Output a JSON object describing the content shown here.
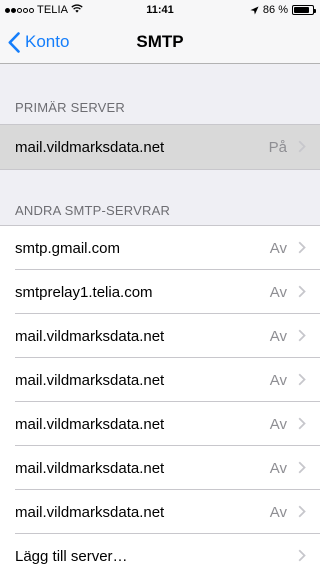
{
  "status_bar": {
    "signal": [
      true,
      true,
      false,
      false,
      false
    ],
    "carrier": "TELIA",
    "time": "11:41",
    "battery_text": "86 %",
    "battery_level": 0.86
  },
  "nav": {
    "back_label": "Konto",
    "title": "SMTP"
  },
  "primary": {
    "header": "PRIMÄR SERVER",
    "server": {
      "label": "mail.vildmarksdata.net",
      "status": "På"
    }
  },
  "others": {
    "header": "ANDRA SMTP-SERVRAR",
    "servers": [
      {
        "label": "smtp.gmail.com",
        "status": "Av"
      },
      {
        "label": "smtprelay1.telia.com",
        "status": "Av"
      },
      {
        "label": "mail.vildmarksdata.net",
        "status": "Av"
      },
      {
        "label": "mail.vildmarksdata.net",
        "status": "Av"
      },
      {
        "label": "mail.vildmarksdata.net",
        "status": "Av"
      },
      {
        "label": "mail.vildmarksdata.net",
        "status": "Av"
      },
      {
        "label": "mail.vildmarksdata.net",
        "status": "Av"
      }
    ],
    "add_label": "Lägg till server…"
  },
  "colors": {
    "accent": "#157efb",
    "background": "#efeff4",
    "secondary_text": "#8e8e93",
    "highlight": "#d9d9d9"
  },
  "icons": {
    "back": "chevron-left-icon",
    "disclosure": "chevron-right-icon",
    "wifi": "wifi-icon",
    "location": "location-arrow-icon",
    "battery": "battery-icon"
  }
}
